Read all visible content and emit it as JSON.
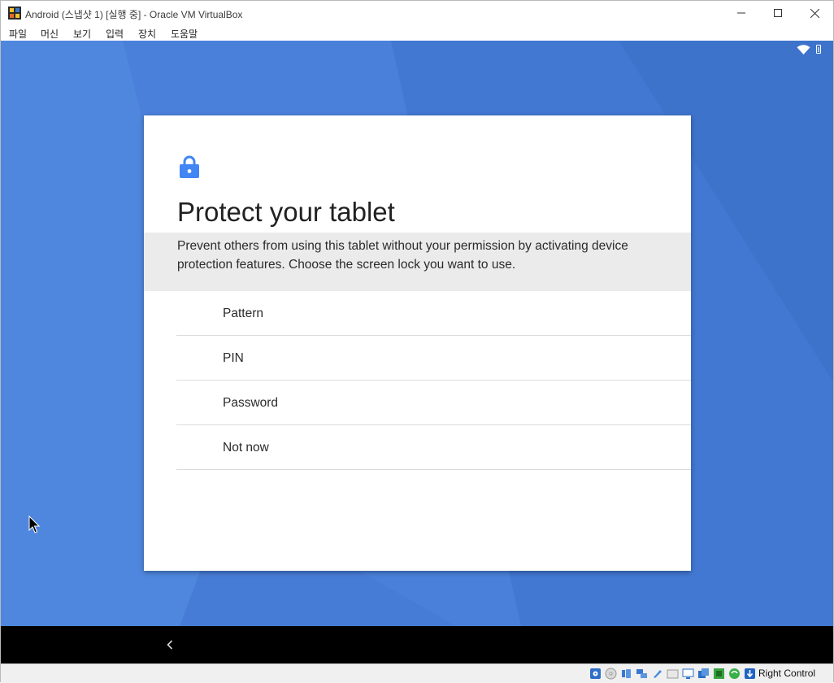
{
  "window": {
    "title": "Android (스냅샷 1) [실행 중] - Oracle VM VirtualBox"
  },
  "menu": [
    {
      "label": "파일"
    },
    {
      "label": "머신"
    },
    {
      "label": "보기"
    },
    {
      "label": "입력"
    },
    {
      "label": "장치"
    },
    {
      "label": "도움말"
    }
  ],
  "android": {
    "status_icons": [
      "wifi-icon",
      "battery-icon"
    ],
    "setup": {
      "icon": "lock-icon",
      "title": "Protect your tablet",
      "description": "Prevent others from using this tablet without your permission by activating device protection features. Choose the screen lock you want to use.",
      "options": [
        {
          "label": "Pattern"
        },
        {
          "label": "PIN"
        },
        {
          "label": "Password"
        },
        {
          "label": "Not now"
        }
      ]
    },
    "nav": {
      "back_icon": "back-chevron-icon"
    }
  },
  "vbox_status": {
    "host_key": "Right Control"
  },
  "colors": {
    "wallpaper": "#4a7fd8",
    "accent": "#4285f4",
    "description_band": "#ebebeb"
  }
}
